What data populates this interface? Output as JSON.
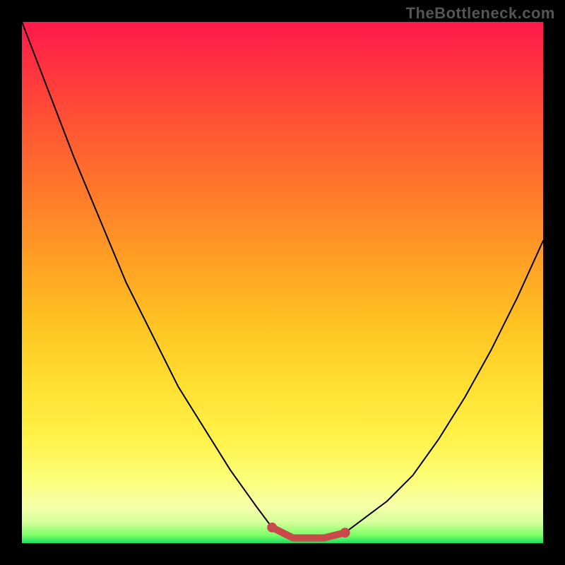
{
  "watermark": "TheBottleneck.com",
  "chart_data": {
    "type": "line",
    "title": "",
    "xlabel": "",
    "ylabel": "",
    "xlim": [
      0,
      100
    ],
    "ylim": [
      0,
      100
    ],
    "series": [
      {
        "name": "curve",
        "x": [
          0,
          5,
          10,
          15,
          20,
          25,
          30,
          35,
          40,
          45,
          48,
          52,
          55,
          58,
          62,
          66,
          70,
          75,
          80,
          85,
          90,
          95,
          100
        ],
        "values": [
          100,
          87,
          74,
          62,
          50,
          40,
          30,
          22,
          14,
          7,
          3,
          1,
          1,
          1,
          2,
          5,
          8,
          13,
          20,
          28,
          37,
          47,
          58
        ]
      }
    ],
    "annotations": {
      "bottom_band": {
        "left_x": 48,
        "right_x": 62,
        "color": "#c94a4a"
      }
    },
    "background_gradient": {
      "direction": "vertical",
      "stops": [
        {
          "pos": 0.0,
          "color": "#ff1a4d"
        },
        {
          "pos": 0.5,
          "color": "#ffb524"
        },
        {
          "pos": 0.85,
          "color": "#fff24a"
        },
        {
          "pos": 1.0,
          "color": "#19e062"
        }
      ]
    }
  }
}
